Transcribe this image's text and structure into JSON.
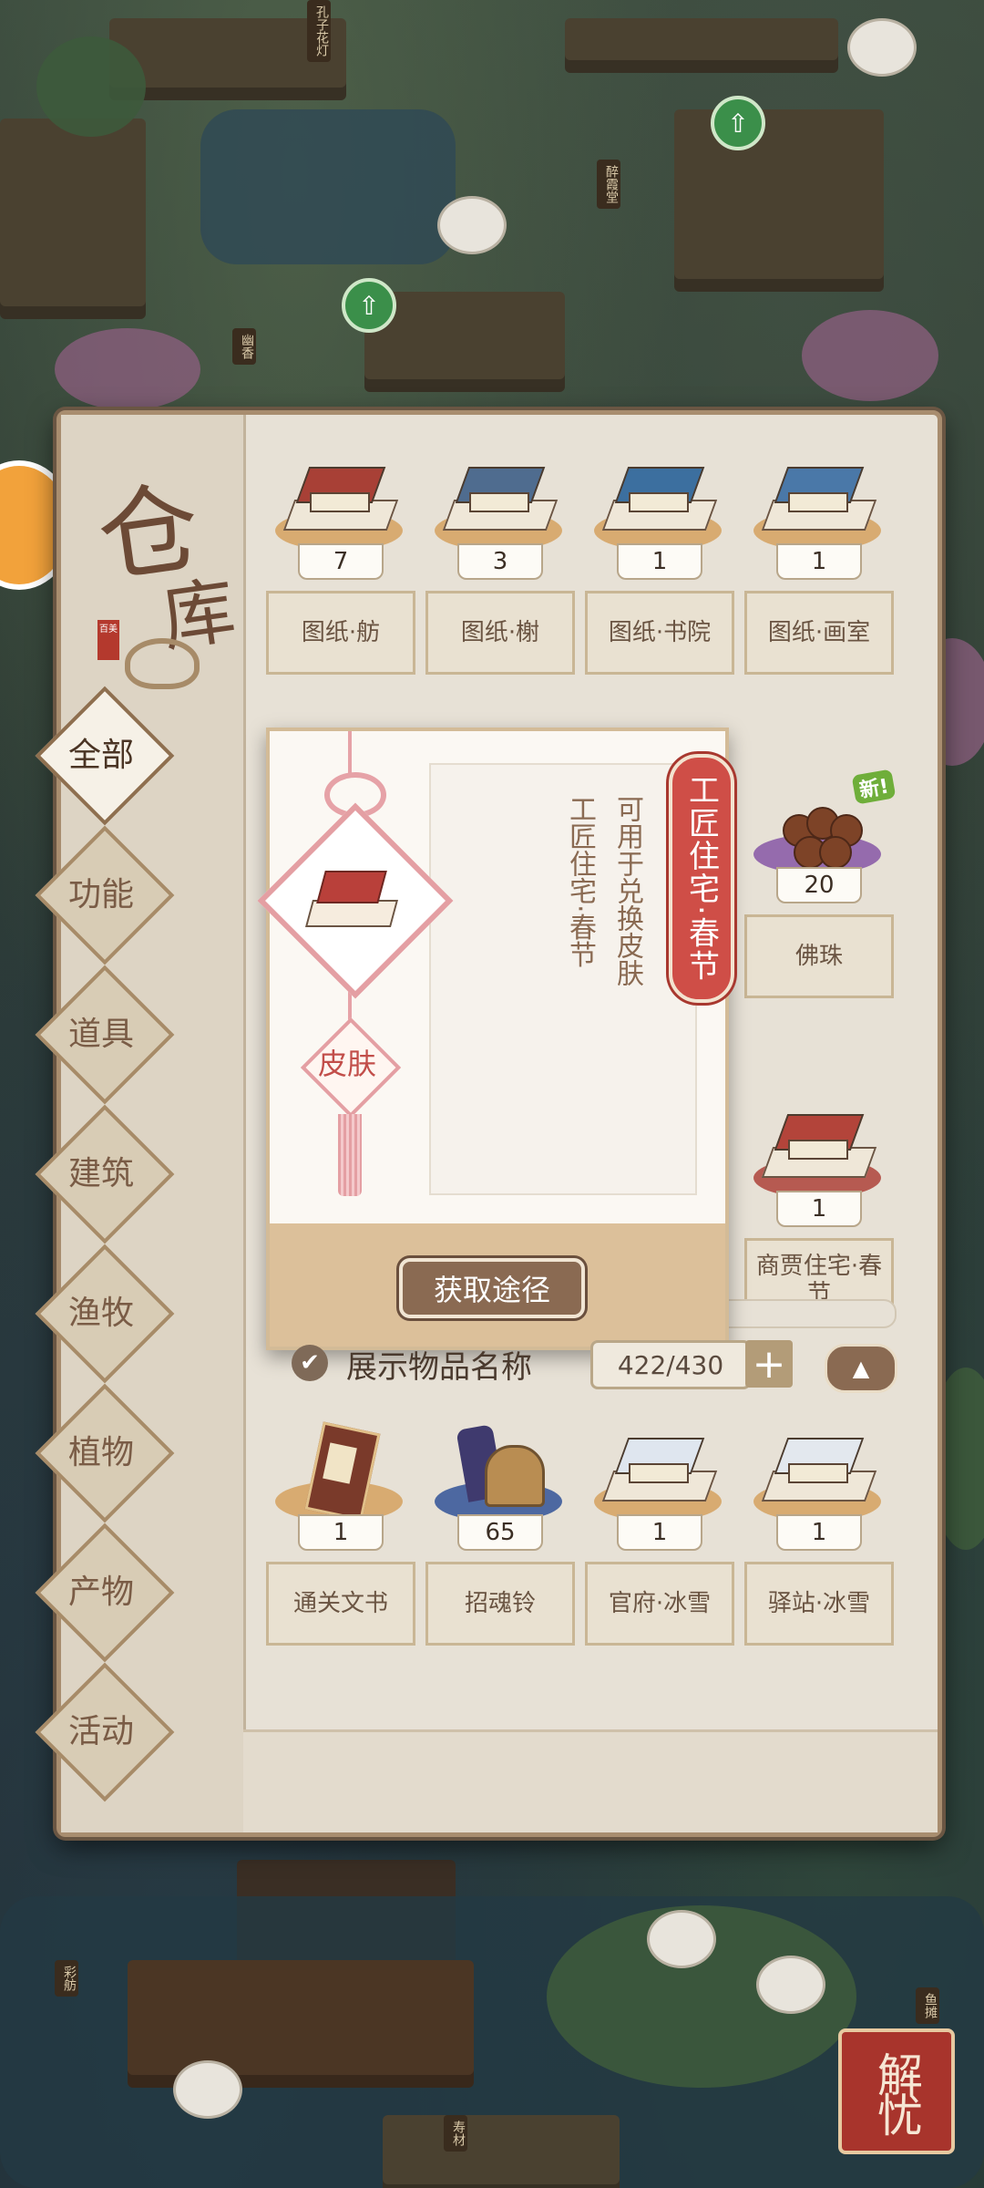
{
  "window": {
    "title": "仓库",
    "title_line1": "仓",
    "title_line2": "库",
    "stamp_text": "百美"
  },
  "categories": [
    {
      "label": "全部",
      "active": true
    },
    {
      "label": "功能",
      "active": false
    },
    {
      "label": "道具",
      "active": false
    },
    {
      "label": "建筑",
      "active": false
    },
    {
      "label": "渔牧",
      "active": false
    },
    {
      "label": "植物",
      "active": false
    },
    {
      "label": "产物",
      "active": false
    },
    {
      "label": "活动",
      "active": false
    }
  ],
  "items_row1": [
    {
      "count": "7",
      "name": "图纸·舫"
    },
    {
      "count": "3",
      "name": "图纸·榭"
    },
    {
      "count": "1",
      "name": "图纸·书院"
    },
    {
      "count": "1",
      "name": "图纸·画室"
    }
  ],
  "items_row2_visible": [
    {
      "count": "20",
      "name": "佛珠",
      "badge": "新!"
    }
  ],
  "items_row3_visible": [
    {
      "count": "1",
      "name": "商贾住宅·春节"
    }
  ],
  "items_row4": [
    {
      "count": "1",
      "name": "通关文书"
    },
    {
      "count": "65",
      "name": "招魂铃"
    },
    {
      "count": "1",
      "name": "官府·冰雪"
    },
    {
      "count": "1",
      "name": "驿站·冰雪"
    }
  ],
  "tooltip": {
    "item_name": "工匠住宅·春节",
    "description": "可用于兑换皮肤",
    "type_label": "皮肤",
    "source_button": "获取途径"
  },
  "footer": {
    "show_names_label": "展示物品名称",
    "show_names_checked": true,
    "capacity": "422/430",
    "plus": "+",
    "collapse_icon": "up-arrow"
  },
  "background": {
    "sign1": "幽香",
    "sign2": "醉霞堂",
    "sign3": "彩舫",
    "sign4": "鱼摊",
    "sign5": "寿材",
    "sign6": "孔子花灯",
    "seal_text": "解忧"
  },
  "colors": {
    "panel_bg": "#e7e1d6",
    "accent_brown": "#8a6a52",
    "red_tag": "#cf4e47",
    "pink_trim": "#e49fa3"
  }
}
